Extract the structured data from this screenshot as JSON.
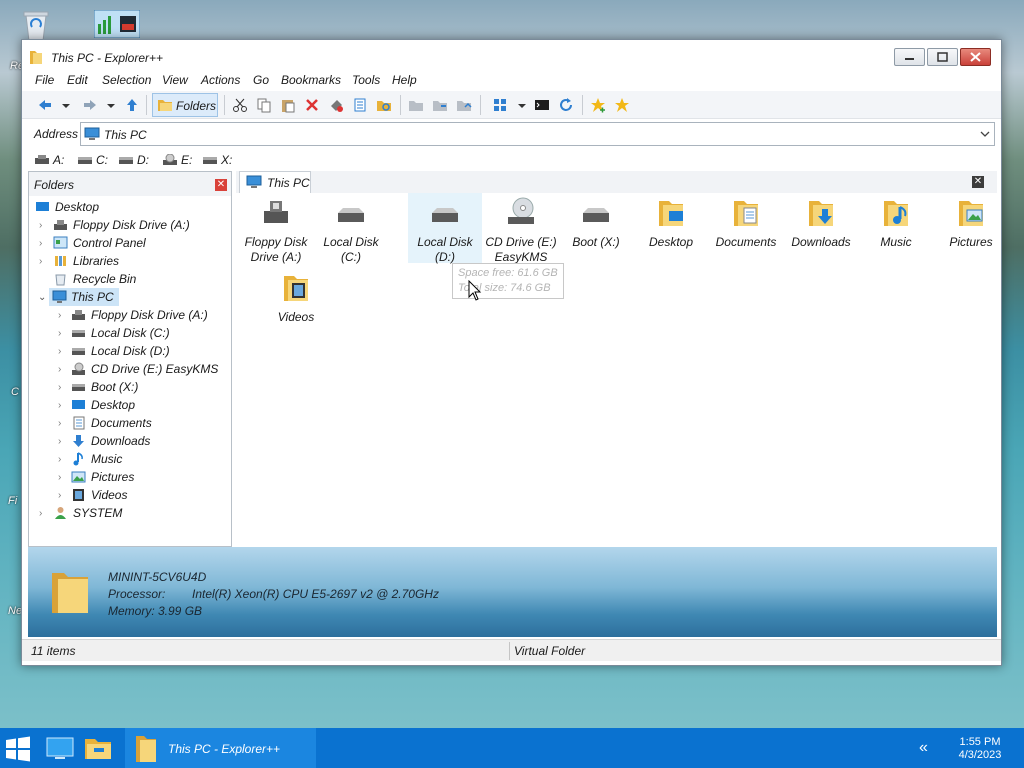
{
  "desktop": {
    "icons": [
      {
        "name": "recycle-bin-icon",
        "label": "Re"
      },
      {
        "name": "system-monitor-icon",
        "label": ""
      }
    ],
    "side_labels": [
      "Re",
      "C",
      "Fi",
      "Ne"
    ]
  },
  "window": {
    "title": "This PC - Explorer++",
    "menu": [
      "File",
      "Edit",
      "Selection",
      "View",
      "Actions",
      "Go",
      "Bookmarks",
      "Tools",
      "Help"
    ],
    "toolbar": {
      "folders_label": "Folders"
    },
    "address": {
      "label": "Address",
      "value": "This PC"
    },
    "drives": [
      "A:",
      "C:",
      "D:",
      "E:",
      "X:"
    ],
    "tree": {
      "header": "Folders",
      "items": [
        {
          "label": "Desktop",
          "level": 0,
          "icon": "desktop-icon"
        },
        {
          "label": "Floppy Disk Drive (A:)",
          "level": 1,
          "icon": "floppy-icon"
        },
        {
          "label": "Control Panel",
          "level": 1,
          "icon": "control-panel-icon"
        },
        {
          "label": "Libraries",
          "level": 1,
          "icon": "libraries-icon"
        },
        {
          "label": "Recycle Bin",
          "level": 1,
          "icon": "recycle-bin-icon"
        },
        {
          "label": "This PC",
          "level": 1,
          "icon": "this-pc-icon",
          "selected": true,
          "expanded": true
        },
        {
          "label": "Floppy Disk Drive (A:)",
          "level": 2,
          "icon": "floppy-icon"
        },
        {
          "label": "Local Disk (C:)",
          "level": 2,
          "icon": "disk-icon"
        },
        {
          "label": "Local Disk (D:)",
          "level": 2,
          "icon": "disk-icon"
        },
        {
          "label": "CD Drive (E:) EasyKMS",
          "level": 2,
          "icon": "cd-drive-icon"
        },
        {
          "label": "Boot (X:)",
          "level": 2,
          "icon": "disk-icon"
        },
        {
          "label": "Desktop",
          "level": 2,
          "icon": "desktop-icon"
        },
        {
          "label": "Documents",
          "level": 2,
          "icon": "documents-icon"
        },
        {
          "label": "Downloads",
          "level": 2,
          "icon": "downloads-icon"
        },
        {
          "label": "Music",
          "level": 2,
          "icon": "music-icon"
        },
        {
          "label": "Pictures",
          "level": 2,
          "icon": "pictures-icon"
        },
        {
          "label": "Videos",
          "level": 2,
          "icon": "videos-icon"
        },
        {
          "label": "SYSTEM",
          "level": 1,
          "icon": "user-icon"
        }
      ]
    },
    "tab": {
      "label": "This PC"
    },
    "items": [
      {
        "label": "Floppy Disk Drive (A:)",
        "icon": "floppy-icon"
      },
      {
        "label": "Local Disk (C:)",
        "icon": "disk-icon"
      },
      {
        "label": "Local Disk (D:)",
        "icon": "disk-icon",
        "hover": true
      },
      {
        "label": "CD Drive (E:) EasyKMS",
        "icon": "cd-drive-icon"
      },
      {
        "label": "Boot (X:)",
        "icon": "disk-icon"
      },
      {
        "label": "Desktop",
        "icon": "desktop-folder-icon"
      },
      {
        "label": "Documents",
        "icon": "documents-folder-icon"
      },
      {
        "label": "Downloads",
        "icon": "downloads-folder-icon"
      },
      {
        "label": "Music",
        "icon": "music-folder-icon"
      },
      {
        "label": "Pictures",
        "icon": "pictures-folder-icon"
      },
      {
        "label": "Videos",
        "icon": "videos-folder-icon"
      }
    ],
    "tooltip": {
      "line1": "Space free: 61.6 GB",
      "line2": "Total size: 74.6 GB"
    },
    "details": {
      "computer_name": "MININT-5CV6U4D",
      "processor_label": "Processor:",
      "processor_value": "Intel(R) Xeon(R) CPU E5-2697 v2 @ 2.70GHz",
      "memory": "Memory: 3.99 GB"
    },
    "status": {
      "items_count": "11 items",
      "location": "Virtual Folder"
    }
  },
  "taskbar": {
    "active_title": "This PC - Explorer++",
    "time": "1:55 PM",
    "date": "4/3/2023"
  }
}
